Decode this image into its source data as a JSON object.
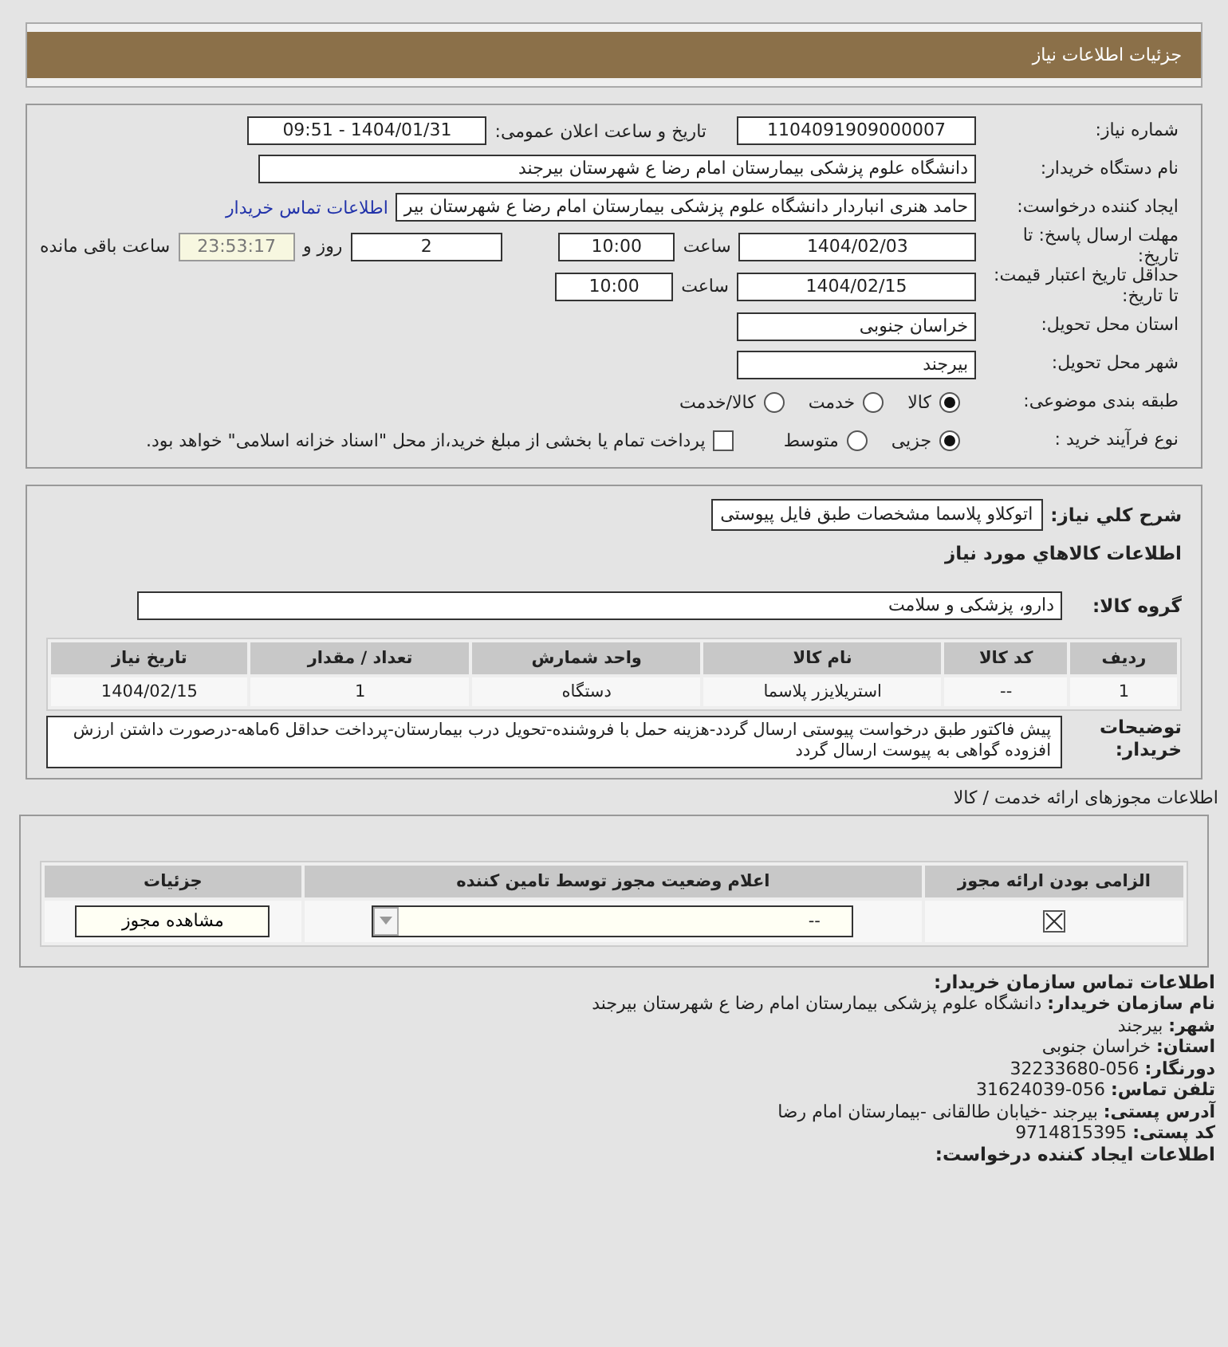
{
  "header": {
    "title": "جزئیات اطلاعات نیاز"
  },
  "form": {
    "need_number": {
      "label": "شماره نیاز:",
      "value": "1104091909000007"
    },
    "announce": {
      "label": "تاریخ و ساعت اعلان عمومی:",
      "value": "1404/01/31 - 09:51"
    },
    "buyer": {
      "label": "نام دستگاه خریدار:",
      "value": "دانشگاه علوم پزشکی  بیمارستان امام رضا ع  شهرستان بیرجند"
    },
    "requester": {
      "label": "ایجاد کننده درخواست:",
      "value": "حامد هنری انباردار دانشگاه علوم پزشکی  بیمارستان امام رضا ع  شهرستان بیر",
      "link": "اطلاعات تماس خریدار"
    },
    "deadline": {
      "label": "مهلت ارسال پاسخ: تا تاریخ:",
      "date": "1404/02/03",
      "time_label": "ساعت",
      "time": "10:00",
      "days": "2",
      "days_label": "روز و",
      "remaining": "23:53:17",
      "remaining_label": "ساعت باقی مانده"
    },
    "validity": {
      "label": "حداقل تاریخ اعتبار قیمت: تا تاریخ:",
      "date": "1404/02/15",
      "time_label": "ساعت",
      "time": "10:00"
    },
    "province": {
      "label": "استان محل تحویل:",
      "value": "خراسان جنوبی"
    },
    "city": {
      "label": "شهر محل تحویل:",
      "value": "بیرجند"
    },
    "category": {
      "label": "طبقه بندی موضوعی:",
      "options": [
        {
          "label": "کالا",
          "selected": true
        },
        {
          "label": "خدمت",
          "selected": false
        },
        {
          "label": "کالا/خدمت",
          "selected": false
        }
      ]
    },
    "process": {
      "label": "نوع فرآیند خرید :",
      "options": [
        {
          "label": "جزیی",
          "selected": true
        },
        {
          "label": "متوسط",
          "selected": false
        }
      ],
      "payment": {
        "checked": false,
        "label": "پرداخت تمام یا بخشی از مبلغ خرید،از محل \"اسناد خزانه اسلامی\" خواهد بود."
      }
    }
  },
  "details": {
    "summary": {
      "label": "شرح کلي نياز:",
      "value": "اتوکلاو پلاسما مشخصات طبق فایل پیوستی"
    },
    "items_title": "اطلاعات کالاهاي مورد نياز",
    "group": {
      "label": "گروه کالا:",
      "value": "دارو، پزشکی و سلامت"
    },
    "table": {
      "columns": [
        "ردیف",
        "کد کالا",
        "نام کالا",
        "واحد شمارش",
        "تعداد / مقدار",
        "تاریخ نیاز"
      ],
      "rows": [
        [
          "1",
          "--",
          "استریلایزر پلاسما",
          "دستگاه",
          "1",
          "1404/02/15"
        ]
      ]
    },
    "notes": {
      "label": "توضیحات خریدار:",
      "value": "پیش فاکتور طبق درخواست پیوستی ارسال گردد-هزینه حمل با فروشنده-تحویل درب بیمارستان-پرداخت حداقل 6ماهه-درصورت داشتن ارزش افزوده گواهی به پیوست ارسال گردد"
    }
  },
  "licenses": {
    "title": "اطلاعات مجوزهای ارائه خدمت / کالا",
    "columns": [
      "الزامی بودن ارائه مجوز",
      "اعلام وضعیت مجوز توسط تامین کننده",
      "جزئیات"
    ],
    "rows": [
      {
        "required": true,
        "status": "--",
        "button": "مشاهده مجوز"
      }
    ]
  },
  "contact": {
    "title": "اطلاعات تماس سازمان خریدار:",
    "lines": [
      {
        "label": "نام سازمان خریدار:",
        "value": "دانشگاه علوم پزشکی بیمارستان امام رضا ع شهرستان بیرجند"
      },
      {
        "label": "شهر:",
        "value": "بیرجند"
      },
      {
        "label": "استان:",
        "value": "خراسان جنوبی"
      },
      {
        "label": "دورنگار:",
        "value": "056-32233680"
      },
      {
        "label": "تلفن تماس:",
        "value": "056-31624039"
      },
      {
        "label": "آدرس پستی:",
        "value": "بیرجند -خیابان طالقانی -بیمارستان امام رضا"
      },
      {
        "label": "کد پستی:",
        "value": "9714815395"
      }
    ],
    "next_title": "اطلاعات ایجاد کننده درخواست:"
  }
}
